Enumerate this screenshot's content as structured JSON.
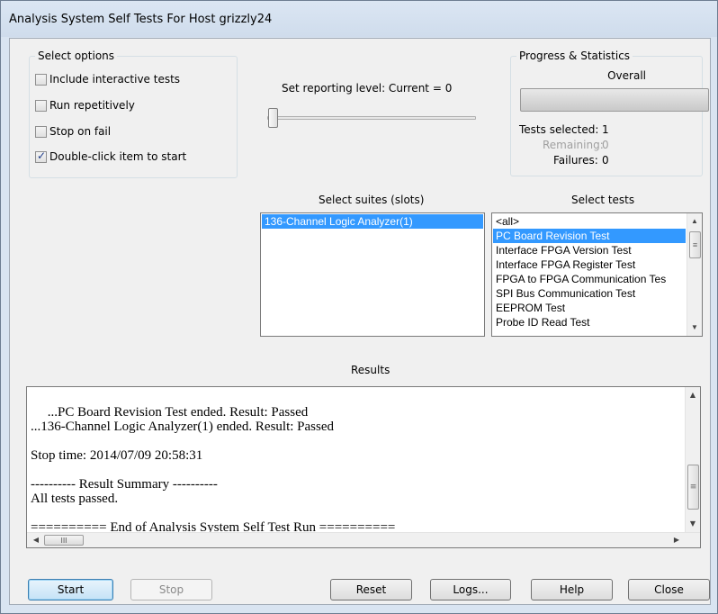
{
  "window": {
    "title": "Analysis System Self Tests For Host grizzly24"
  },
  "options": {
    "group_label": "Select options",
    "items": [
      {
        "label": "Include interactive tests",
        "checked": false
      },
      {
        "label": "Run repetitively",
        "checked": false
      },
      {
        "label": "Stop on fail",
        "checked": false
      },
      {
        "label": "Double-click item to start",
        "checked": true
      }
    ]
  },
  "reporting": {
    "label": "Set reporting level: Current = 0",
    "level": 0
  },
  "progress": {
    "group_label": "Progress & Statistics",
    "overall_label": "Overall",
    "overall_fraction": 0,
    "tests_selected_label": "Tests selected:",
    "tests_selected_value": "1",
    "remaining_label": "Remaining:",
    "remaining_value": "0",
    "failures_label": "Failures:",
    "failures_value": "0"
  },
  "suites": {
    "label": "Select suites (slots)",
    "items": [
      "136-Channel Logic Analyzer(1)"
    ],
    "selected_index": 0
  },
  "tests": {
    "label": "Select tests",
    "items": [
      "<all>",
      "PC Board Revision Test",
      "Interface FPGA Version Test",
      "Interface FPGA Register Test",
      "FPGA to FPGA Communication Tes",
      "SPI Bus Communication Test",
      "EEPROM Test",
      "Probe ID Read Test"
    ],
    "selected_index": 1
  },
  "results": {
    "label": "Results",
    "lines": [
      "     ...PC Board Revision Test ended. Result: Passed",
      "...136-Channel Logic Analyzer(1) ended. Result: Passed",
      "",
      "Stop time: 2014/07/09 20:58:31",
      "",
      "---------- Result Summary ----------",
      "All tests passed.",
      "",
      "========== End of Analysis System Self Test Run =========="
    ]
  },
  "buttons": {
    "start": "Start",
    "stop": "Stop",
    "reset": "Reset",
    "logs": "Logs...",
    "help": "Help",
    "close": "Close"
  },
  "scroll_glyphs": {
    "up": "▲",
    "down": "▼",
    "left": "◀",
    "right": "▶",
    "grip": "≡",
    "hgrip": "III"
  }
}
